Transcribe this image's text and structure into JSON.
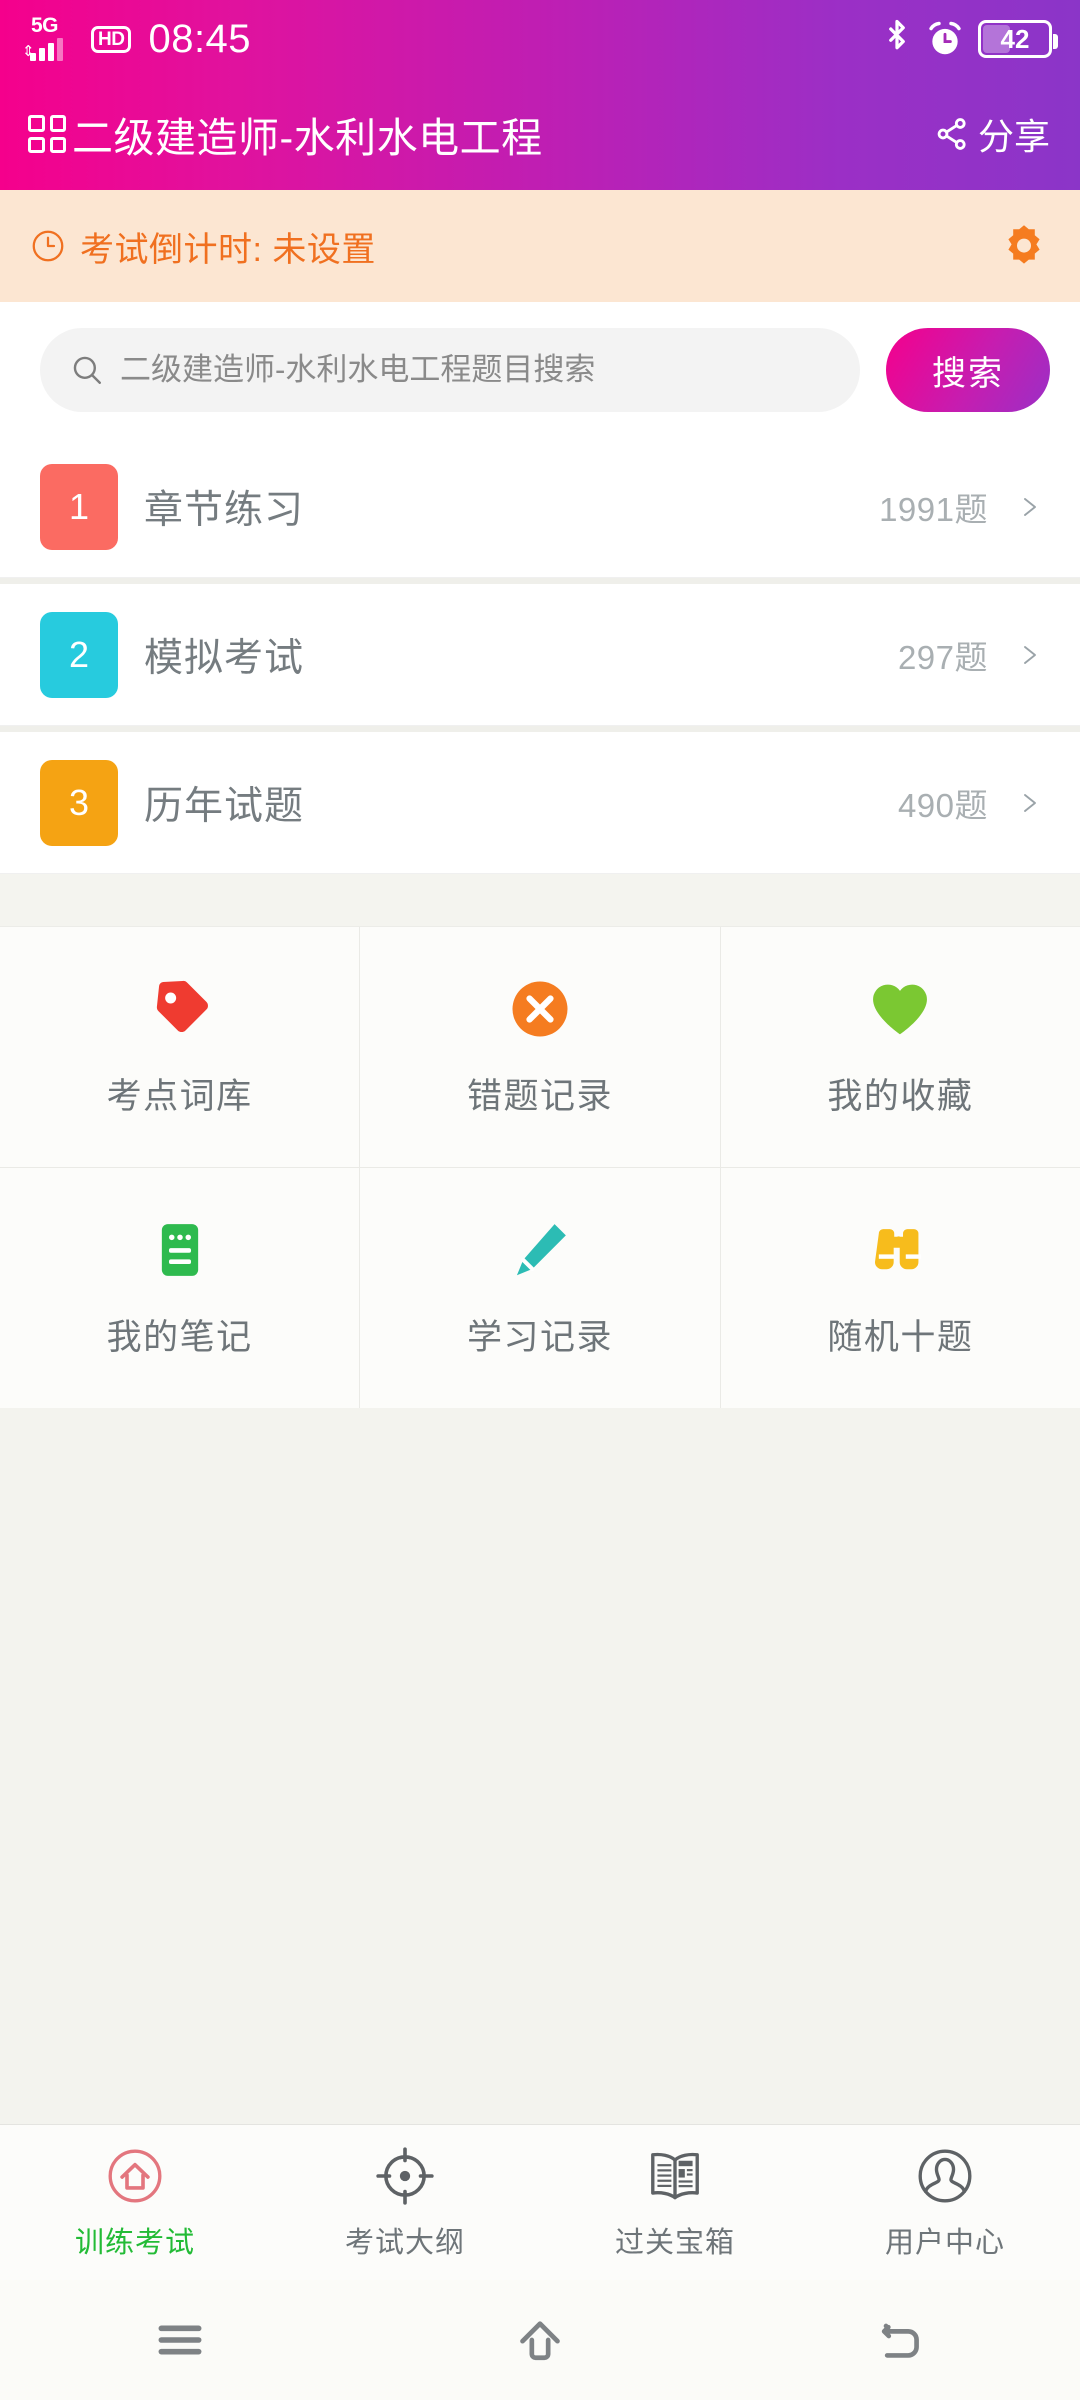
{
  "status_bar": {
    "network_label": "5G",
    "hd_label": "HD",
    "time": "08:45",
    "bluetooth_icon": "bluetooth-icon",
    "alarm_icon": "alarm-clock-icon",
    "battery_level": "42"
  },
  "header": {
    "grid_icon": "grid-icon",
    "title": "二级建造师-水利水电工程",
    "share_icon": "share-icon",
    "share_label": "分享",
    "gradient_start": "#F5008C",
    "gradient_end": "#8B35C8"
  },
  "countdown": {
    "clock_icon": "clock-icon",
    "text": "考试倒计时: 未设置",
    "settings_icon": "gear-icon",
    "accent_color": "#F07020",
    "background_color": "#FCE6D2"
  },
  "search": {
    "search_icon": "search-icon",
    "placeholder": "二级建造师-水利水电工程题目搜索",
    "value": "",
    "button_label": "搜索"
  },
  "practice_list": [
    {
      "index": "1",
      "label": "章节练习",
      "count": "1991题",
      "badge_color": "#FB6B62",
      "chevron_icon": "chevron-right-icon"
    },
    {
      "index": "2",
      "label": "模拟考试",
      "count": "297题",
      "badge_color": "#27CBDE",
      "chevron_icon": "chevron-right-icon"
    },
    {
      "index": "3",
      "label": "历年试题",
      "count": "490题",
      "badge_color": "#F5A313",
      "chevron_icon": "chevron-right-icon"
    }
  ],
  "feature_grid": [
    [
      {
        "label": "考点词库",
        "icon": "tag-icon",
        "color": "#EF3B30"
      },
      {
        "label": "错题记录",
        "icon": "circle-x-icon",
        "color": "#F57C20"
      },
      {
        "label": "我的收藏",
        "icon": "heart-icon",
        "color": "#7BC832"
      }
    ],
    [
      {
        "label": "我的笔记",
        "icon": "notepad-icon",
        "color": "#2EBA4E"
      },
      {
        "label": "学习记录",
        "icon": "pencil-icon",
        "color": "#2CBCB4"
      },
      {
        "label": "随机十题",
        "icon": "binoculars-icon",
        "color": "#F7BC1C"
      }
    ]
  ],
  "tab_bar": {
    "active_color": "#23BB36",
    "items": [
      {
        "label": "训练考试",
        "icon": "home-circle-icon",
        "active": true
      },
      {
        "label": "考试大纲",
        "icon": "crosshair-icon",
        "active": false
      },
      {
        "label": "过关宝箱",
        "icon": "newspaper-icon",
        "active": false
      },
      {
        "label": "用户中心",
        "icon": "person-circle-icon",
        "active": false
      }
    ]
  },
  "system_nav": {
    "recents_icon": "menu-icon",
    "home_icon": "home-icon",
    "back_icon": "back-icon"
  }
}
